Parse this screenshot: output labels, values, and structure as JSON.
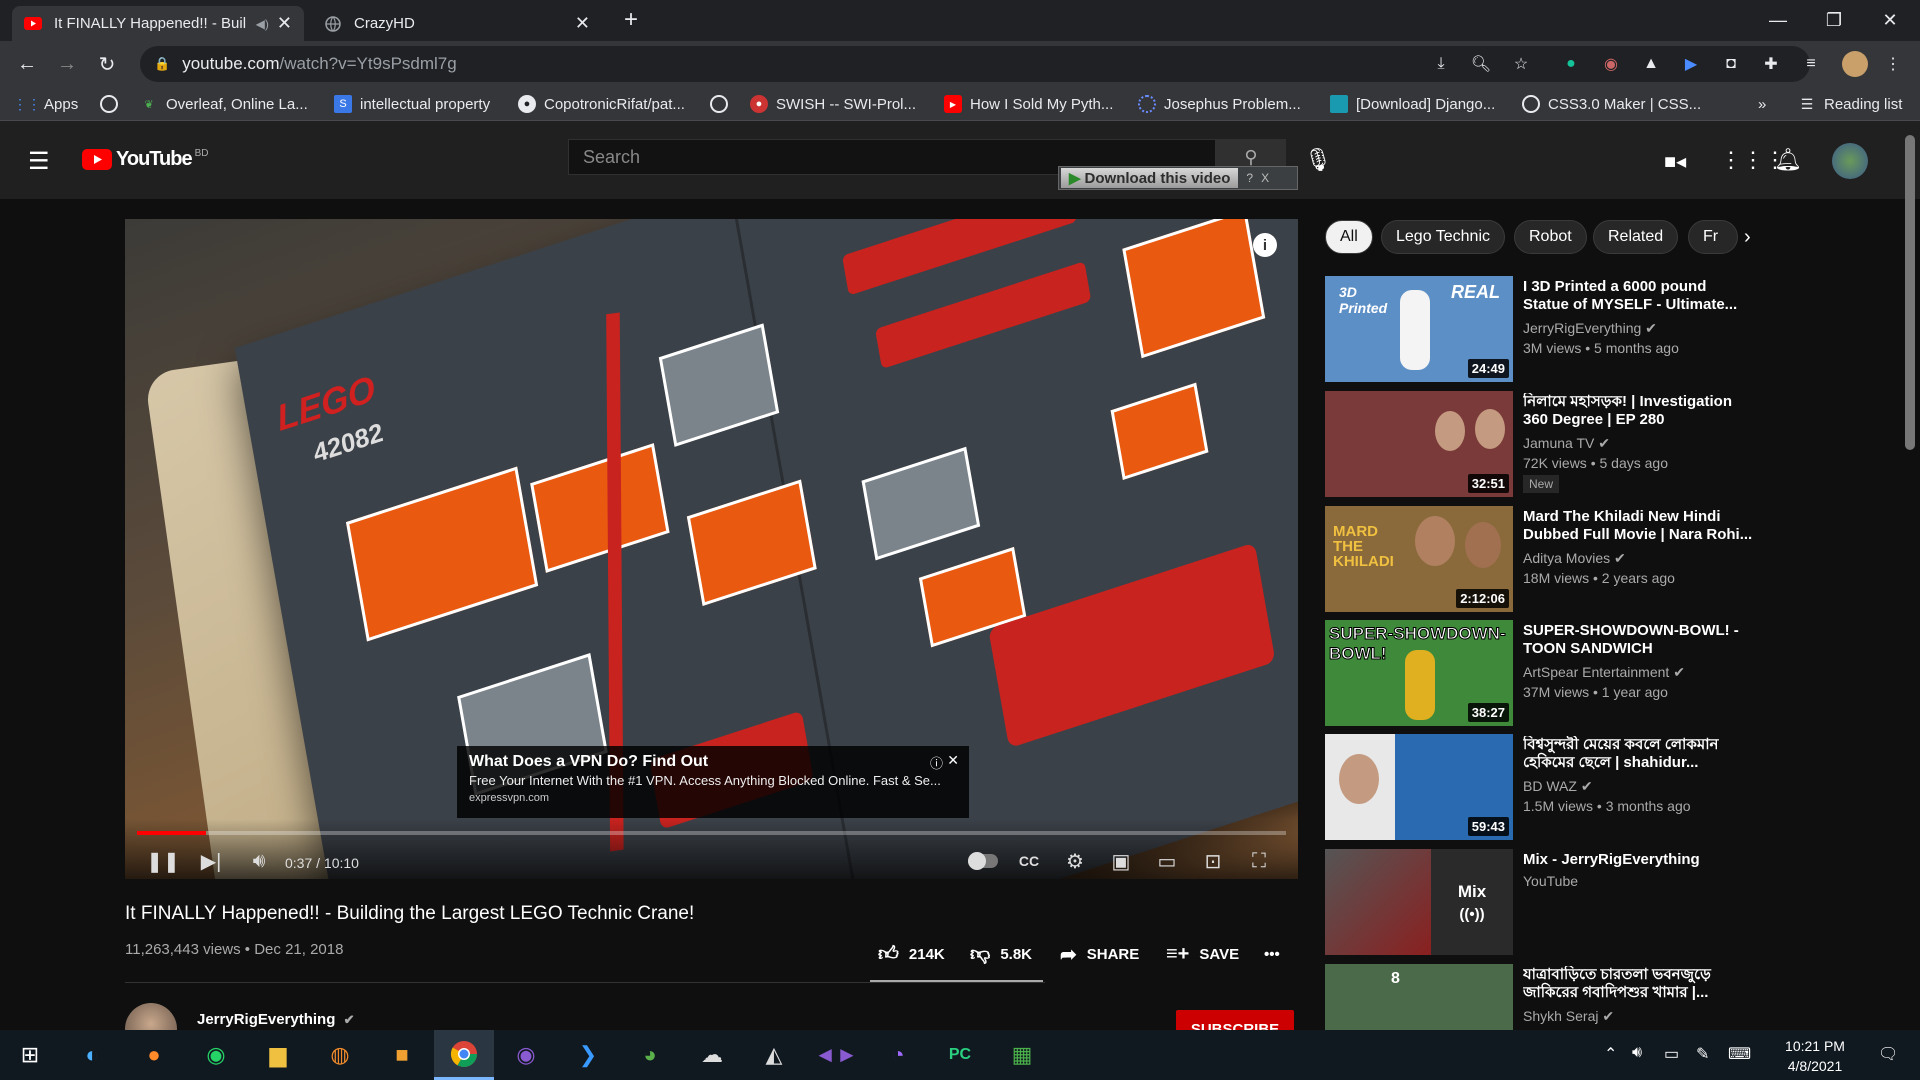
{
  "browser": {
    "tabs": [
      {
        "title": "It FINALLY Happened!! - Buil",
        "active": true
      },
      {
        "title": "CrazyHD",
        "active": false
      }
    ],
    "new_tab": "+",
    "url_host": "youtube.com",
    "url_path": "/watch?v=Yt9sPsdml7g",
    "bookmarks": [
      {
        "label": "Apps",
        "icon": "apps-grid-icon"
      },
      {
        "label": "",
        "icon": "globe-icon"
      },
      {
        "label": "Overleaf, Online La...",
        "icon": "overleaf-icon"
      },
      {
        "label": "intellectual property",
        "icon": "scholar-icon"
      },
      {
        "label": "CopotronicRifat/pat...",
        "icon": "github-icon"
      },
      {
        "label": "",
        "icon": "globe-icon"
      },
      {
        "label": "SWISH -- SWI-Prol...",
        "icon": "swish-icon"
      },
      {
        "label": "How I Sold My Pyth...",
        "icon": "youtube-icon"
      },
      {
        "label": "Josephus Problem...",
        "icon": "loading-icon"
      },
      {
        "label": "[Download] Django...",
        "icon": "django-icon"
      },
      {
        "label": "CSS3.0 Maker | CSS...",
        "icon": "globe-icon"
      }
    ],
    "bookmarks_more": "»",
    "reading_list": "Reading list"
  },
  "youtube": {
    "logo_text": "YouTube",
    "logo_country": "BD",
    "search_placeholder": "Search",
    "download_btn": "Download this video",
    "download_help": "?",
    "download_close": "X"
  },
  "player": {
    "time": "0:37 / 10:10",
    "progress": 0.06,
    "ad": {
      "title": "What Does a VPN Do? Find Out",
      "text": "Free Your Internet With the #1 VPN. Access Anything Blocked Online. Fast & Se...",
      "url": "expressvpn.com"
    },
    "manual_model": "42082"
  },
  "video": {
    "title": "It FINALLY Happened!! - Building the Largest LEGO Technic Crane!",
    "meta": "11,263,443 views • Dec 21, 2018",
    "likes": "214K",
    "dislikes": "5.8K",
    "share": "SHARE",
    "save": "SAVE",
    "channel": "JerryRigEverything",
    "subscribe": "SUBSCRIBE"
  },
  "chips": [
    "All",
    "Lego Technic",
    "Robot",
    "Related",
    "Fr"
  ],
  "related": [
    {
      "title": "I 3D Printed a 6000 pound Statue of MYSELF - Ultimate...",
      "channel": "JerryRigEverything",
      "views": "3M views • 5 months ago",
      "duration": "24:49",
      "thumb_color": "#5d8fc7",
      "badge": ""
    },
    {
      "title": "নিলামে মহাসড়ক! | Investigation 360 Degree | EP 280",
      "channel": "Jamuna TV",
      "views": "72K views • 5 days ago",
      "duration": "32:51",
      "thumb_color": "#7a3a3a",
      "badge": "New"
    },
    {
      "title": "Mard The Khiladi New Hindi Dubbed Full Movie | Nara Rohi...",
      "channel": "Aditya Movies",
      "views": "18M views • 2 years ago",
      "duration": "2:12:06",
      "thumb_color": "#8a6a3a",
      "badge": ""
    },
    {
      "title": "SUPER-SHOWDOWN-BOWL! - TOON SANDWICH",
      "channel": "ArtSpear Entertainment",
      "views": "37M views • 1 year ago",
      "duration": "38:27",
      "thumb_color": "#3f8a3a",
      "badge": ""
    },
    {
      "title": "বিশ্বসুন্দরী মেয়ের কবলে লোকমান হেকিমের ছেলে | shahidur...",
      "channel": "BD WAZ",
      "views": "1.5M views • 3 months ago",
      "duration": "59:43",
      "thumb_color": "#2a6ab0",
      "badge": ""
    },
    {
      "title": "Mix - JerryRigEverything",
      "channel": "YouTube",
      "views": "",
      "duration": "",
      "thumb_color": "#3a3a3a",
      "badge": ""
    },
    {
      "title": "যাত্রাবাড়িতে চারতলা ভবনজুড়ে জাকিরের গবাদিপশুর খামার |...",
      "channel": "Shykh Seraj",
      "views": "",
      "duration": "",
      "thumb_color": "#4a6a4a",
      "badge": ""
    }
  ],
  "mix_label": "Mix",
  "taskbar": {
    "time": "10:21 PM",
    "date": "4/8/2021"
  }
}
